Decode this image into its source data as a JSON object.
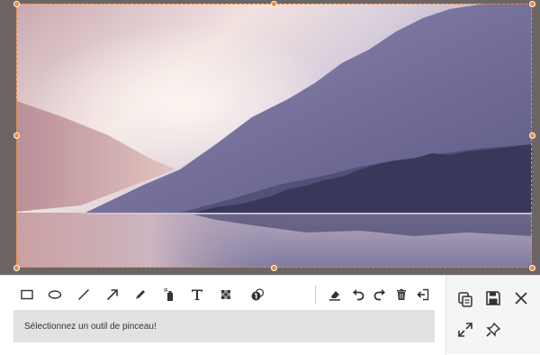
{
  "editor": {
    "hint_text": "Sélectionnez un outil de pinceau!"
  },
  "tools": [
    {
      "name": "rectangle-tool",
      "icon": "rectangle-icon"
    },
    {
      "name": "ellipse-tool",
      "icon": "ellipse-icon"
    },
    {
      "name": "line-tool",
      "icon": "line-icon"
    },
    {
      "name": "arrow-tool",
      "icon": "arrow-icon"
    },
    {
      "name": "pencil-tool",
      "icon": "pencil-icon"
    },
    {
      "name": "spray-tool",
      "icon": "spray-icon"
    },
    {
      "name": "text-tool",
      "icon": "text-icon"
    },
    {
      "name": "mosaic-tool",
      "icon": "mosaic-icon"
    },
    {
      "name": "step-number-tool",
      "icon": "step-number-icon"
    }
  ],
  "actions": [
    {
      "name": "eraser-button",
      "icon": "eraser-icon"
    },
    {
      "name": "undo-button",
      "icon": "undo-icon"
    },
    {
      "name": "redo-button",
      "icon": "redo-icon"
    },
    {
      "name": "delete-button",
      "icon": "trash-icon"
    },
    {
      "name": "exit-button",
      "icon": "exit-icon"
    }
  ],
  "side_actions": [
    {
      "name": "copy-button",
      "icon": "copy-icon"
    },
    {
      "name": "save-button",
      "icon": "save-icon"
    },
    {
      "name": "close-button",
      "icon": "close-icon"
    },
    {
      "name": "fullscreen-button",
      "icon": "expand-icon"
    },
    {
      "name": "pin-button",
      "icon": "pin-icon"
    }
  ],
  "colors": {
    "selection": "#f08a2c",
    "icon": "#333333"
  }
}
